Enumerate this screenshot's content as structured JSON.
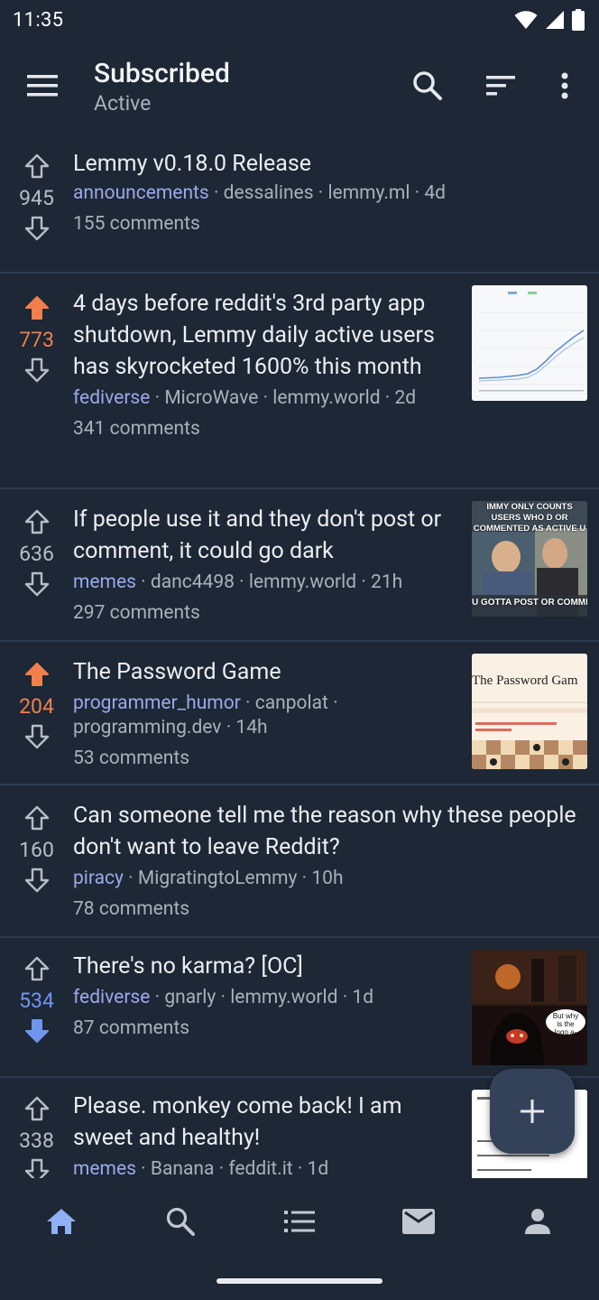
{
  "status": {
    "time": "11:35"
  },
  "header": {
    "title": "Subscribed",
    "subtitle": "Active"
  },
  "posts": [
    {
      "title": "Lemmy v0.18.0 Release",
      "score": "945",
      "vote_state": "none",
      "community": "announcements",
      "sep1": " · ",
      "author": "dessalines",
      "sep2": " · ",
      "instance": "lemmy.ml",
      "sep3": " · ",
      "age": "4d",
      "comments": "155 comments",
      "has_thumb": false
    },
    {
      "title": "4 days before reddit's 3rd party app shutdown, Lemmy daily active users has skyrocketed 1600% this month",
      "score": "773",
      "vote_state": "up",
      "community": "fediverse",
      "sep1": " · ",
      "author": "MicroWave",
      "sep2": " · ",
      "instance": "lemmy.world",
      "sep3": " · ",
      "age": "2d",
      "comments": "341 comments",
      "has_thumb": true,
      "thumb": "chart-thumbnail"
    },
    {
      "title": "If people use it and they don't post or comment, it could go dark",
      "score": "636",
      "vote_state": "none",
      "community": "memes",
      "sep1": " · ",
      "author": "danc4498",
      "sep2": " · ",
      "instance": "lemmy.world",
      "sep3": " · ",
      "age": "21h",
      "comments": "297 comments",
      "has_thumb": true,
      "thumb": "meme-thumbnail",
      "thumb_top": "IMMY ONLY COUNTS USERS WHO D OR COMMENTED AS ACTIVE U",
      "thumb_bottom": "U GOTTA POST OR COMME"
    },
    {
      "title": "The Password Game",
      "score": "204",
      "vote_state": "up",
      "community": "programmer_humor",
      "sep1": " · ",
      "author": "canpolat",
      "sep2": " · ",
      "instance": "programming.dev",
      "sep3": " · ",
      "age": "14h",
      "comments": "53 comments",
      "has_thumb": true,
      "thumb": "password-game-thumbnail",
      "thumb_title": "The Password Gam"
    },
    {
      "title": "Can someone tell me the reason why these people don't want to leave Reddit?",
      "score": "160",
      "vote_state": "none",
      "community": "piracy",
      "sep1": " · ",
      "author": "MigratingtoLemmy",
      "sep2": " · ",
      "instance": "",
      "sep3": " · ",
      "age": "10h",
      "comments": "78 comments",
      "has_thumb": false
    },
    {
      "title": "There's no karma? [OC]",
      "score": "534",
      "vote_state": "down",
      "community": "fediverse",
      "sep1": " · ",
      "author": "gnarly",
      "sep2": " · ",
      "instance": "lemmy.world",
      "sep3": " · ",
      "age": "1d",
      "comments": "87 comments",
      "has_thumb": true,
      "thumb": "comic-thumbnail",
      "thumb_bubble": "But why is the logo a-"
    },
    {
      "title": "Please. monkey come back! I am sweet and healthy!",
      "score": "338",
      "vote_state": "none",
      "community": "memes",
      "sep1": " · ",
      "author": "Banana",
      "sep2": " · ",
      "instance": "feddit.it",
      "sep3": " · ",
      "age": "1d",
      "comments": "",
      "has_thumb": true,
      "thumb": "checklist-thumbnail"
    }
  ],
  "colors": {
    "background": "#1d2735",
    "upvote": "#f27f4b",
    "downvote": "#6f95ee",
    "community": "#9aa9ea",
    "divider": "#2c3b50",
    "fab": "#334258"
  },
  "bottom_nav": [
    "home-icon",
    "search-icon",
    "list-icon",
    "mail-icon",
    "profile-icon"
  ]
}
